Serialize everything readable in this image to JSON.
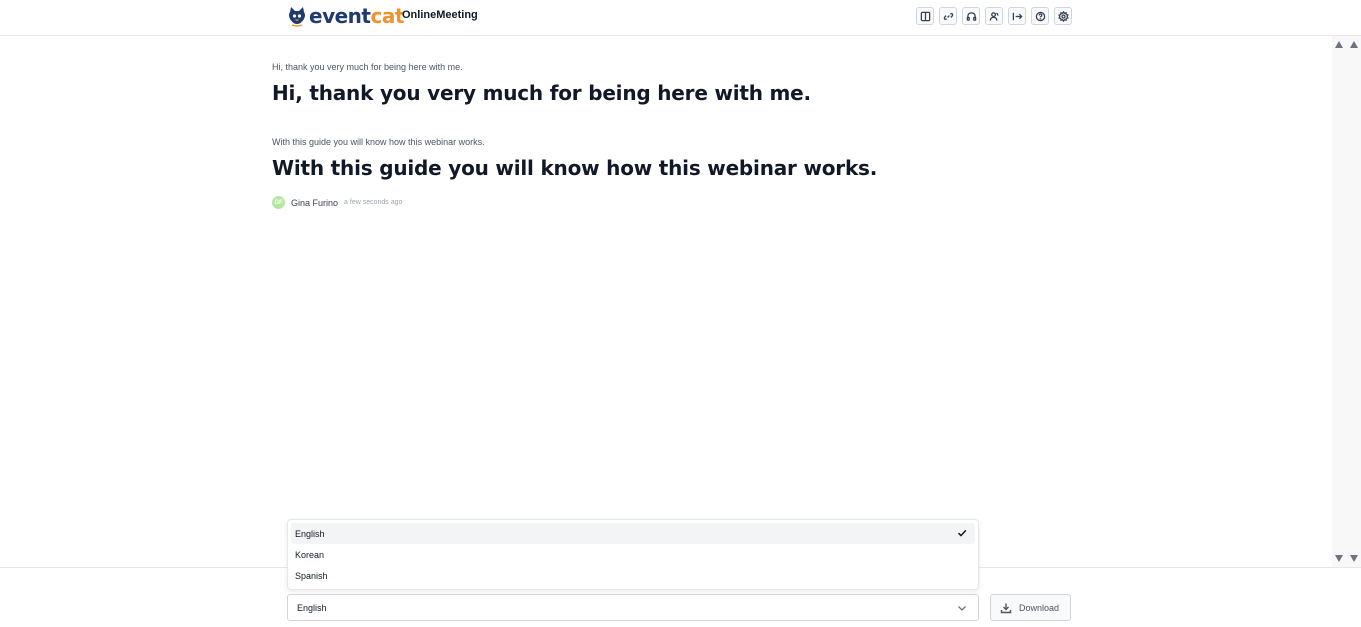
{
  "header": {
    "logo": {
      "part1": "event",
      "part2": "cat"
    },
    "app_name": "OnlineMeeting",
    "toolbar": [
      {
        "icon": "layout-columns-icon"
      },
      {
        "icon": "link-icon"
      },
      {
        "icon": "headphones-icon"
      },
      {
        "icon": "users-icon"
      },
      {
        "icon": "exit-icon"
      },
      {
        "icon": "help-icon"
      },
      {
        "icon": "settings-icon"
      }
    ]
  },
  "transcript": {
    "entries": [
      {
        "original": "Hi, thank you very much for being here with me.",
        "translated": "Hi, thank you very much for being here with me."
      },
      {
        "original": "With this guide you will know how this webinar works.",
        "translated": "With this guide you will know how this webinar works."
      }
    ],
    "author": {
      "initials": "GF",
      "name": "Gina Furino",
      "time": "a few seconds ago"
    }
  },
  "language": {
    "selected": "English",
    "options": [
      "English",
      "Korean",
      "Spanish"
    ]
  },
  "download": {
    "label": "Download"
  },
  "colors": {
    "brand_dark": "#1e3a6e",
    "brand_orange": "#f0932b",
    "avatar": "#b4e7a1"
  }
}
